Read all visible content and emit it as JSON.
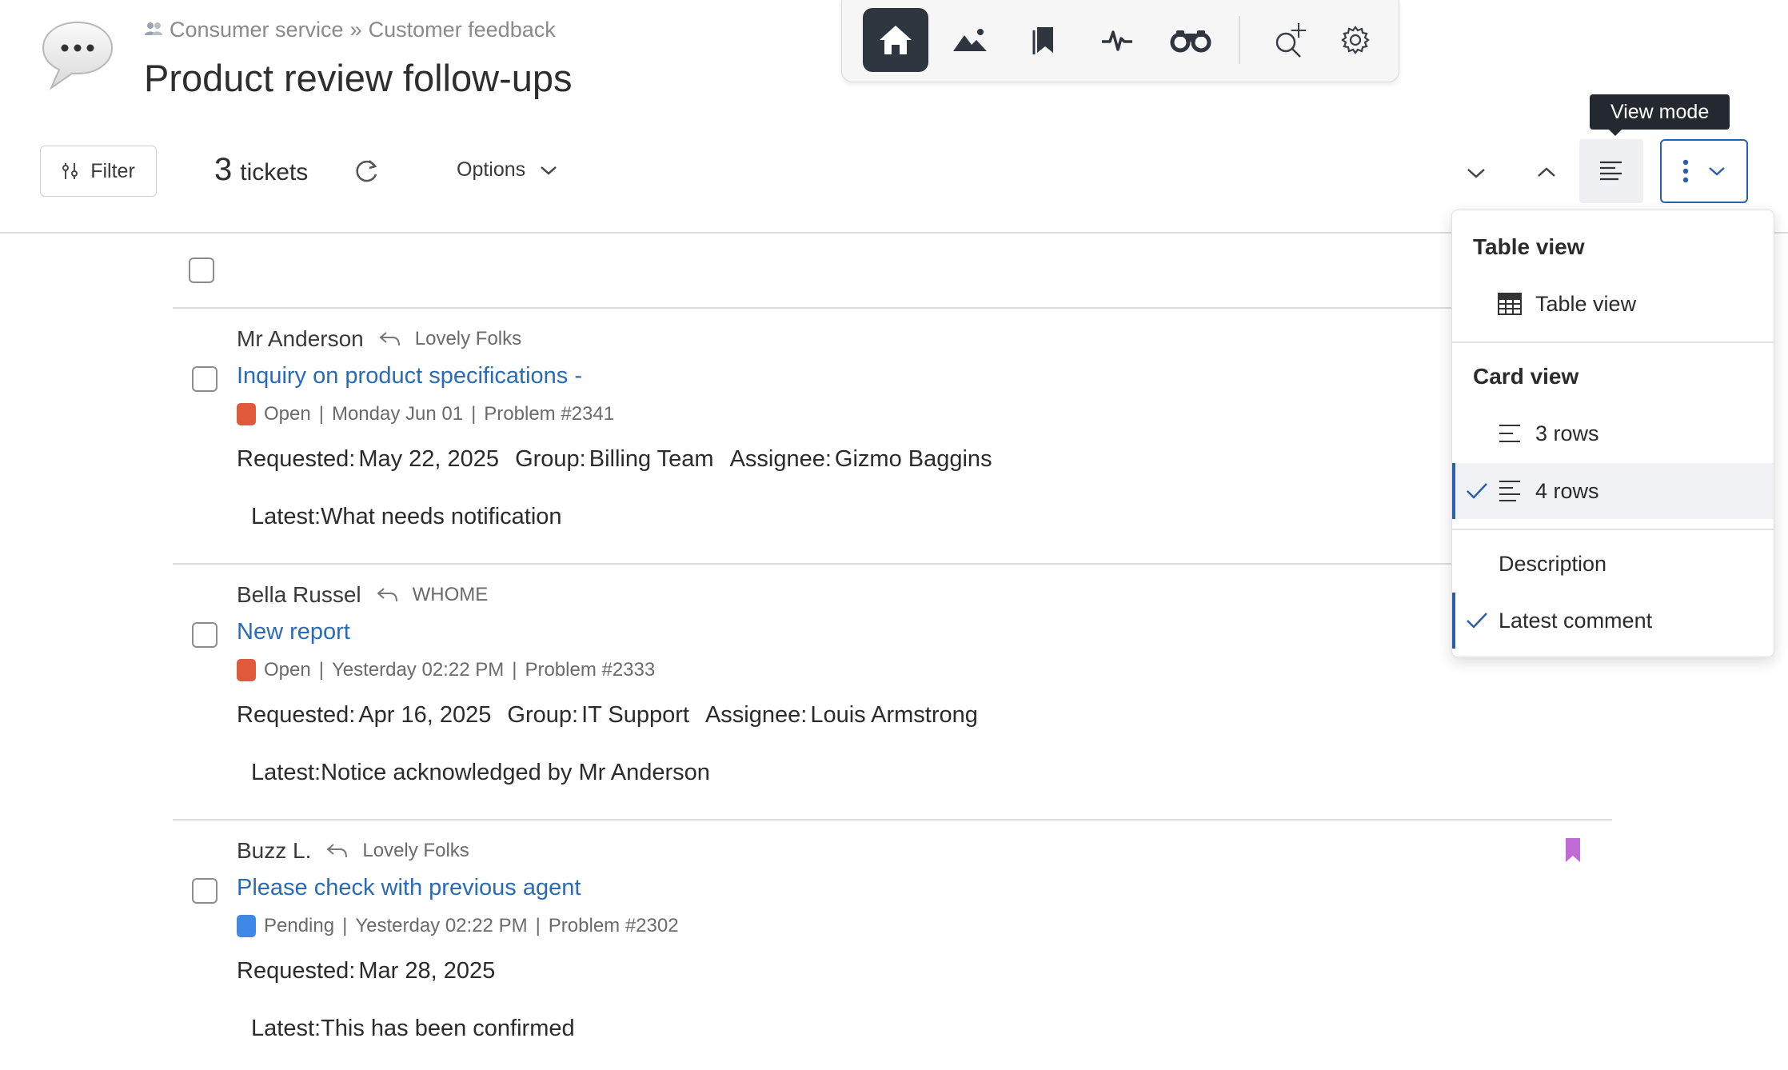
{
  "header": {
    "breadcrumb": [
      "Consumer service",
      "Customer feedback"
    ],
    "breadcrumb_separator": "»",
    "title": "Product review follow-ups"
  },
  "top_toolbar": {
    "items": [
      {
        "icon": "home-icon",
        "active": true
      },
      {
        "icon": "image-icon"
      },
      {
        "icon": "bookmarks-icon"
      },
      {
        "icon": "activity-icon"
      },
      {
        "icon": "binoculars-icon"
      },
      {
        "icon": "search-plus-icon"
      },
      {
        "icon": "gear-icon"
      }
    ]
  },
  "actions": {
    "filter_label": "Filter",
    "ticket_count": "3",
    "ticket_label": "tickets",
    "options_label": "Options",
    "tooltip": "View mode"
  },
  "tickets": [
    {
      "author": "Mr Anderson",
      "org": "Lovely Folks",
      "subject": "Inquiry on product specifications -",
      "status": "Open",
      "status_color": "#e0593a",
      "date": "Monday Jun 01",
      "problem": "Problem #2341",
      "requested_label": "Requested:",
      "requested": "May 22, 2025",
      "group_label": "Group:",
      "group": "Billing Team",
      "assignee_label": "Assignee:",
      "assignee": "Gizmo Baggins",
      "latest_label": "Latest:",
      "latest": "What needs notification"
    },
    {
      "author": "Bella Russel",
      "org": "WHOME",
      "subject": "New report",
      "status": "Open",
      "status_color": "#e0593a",
      "date": "Yesterday 02:22 PM",
      "problem": "Problem #2333",
      "requested_label": "Requested:",
      "requested": "Apr 16, 2025",
      "group_label": "Group:",
      "group": "IT Support",
      "assignee_label": "Assignee:",
      "assignee": "Louis Armstrong",
      "latest_label": "Latest:",
      "latest": "Notice acknowledged by Mr Anderson"
    },
    {
      "author": "Buzz L.",
      "org": "Lovely Folks",
      "subject": "Please check with previous agent",
      "status": "Pending",
      "status_color": "#3f88e6",
      "date": "Yesterday 02:22 PM",
      "problem": "Problem #2302",
      "requested_label": "Requested:",
      "requested": "Mar 28, 2025",
      "latest_label": "Latest:",
      "latest": "This has been confirmed",
      "bookmarked": true,
      "bookmark_color": "#c06ad6"
    }
  ],
  "view_menu": {
    "table_heading": "Table view",
    "table_item": "Table view",
    "card_heading": "Card view",
    "card_items": [
      "3 rows",
      "4 rows"
    ],
    "card_selected": "4 rows",
    "extra_items": [
      "Description",
      "Latest comment"
    ],
    "extra_checked": "Latest comment"
  },
  "colors": {
    "link": "#2a6bb5",
    "accent": "#2a5fad",
    "toolbar_active": "#2f3640"
  }
}
